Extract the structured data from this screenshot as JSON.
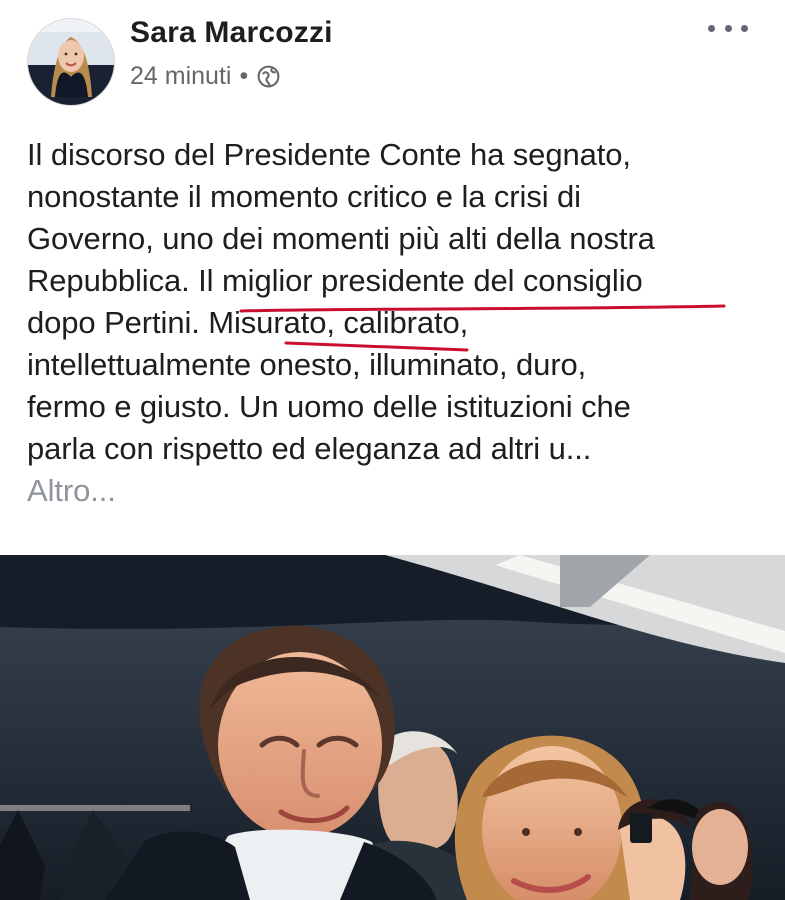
{
  "post": {
    "author": "Sara Marcozzi",
    "time": "24 minuti",
    "separator": "•",
    "privacy_icon": "globe-icon",
    "more_icon": "more-options-icon"
  },
  "text": {
    "lines": [
      "Il discorso del Presidente Conte ha segnato,",
      "nonostante il momento critico e la crisi di",
      "Governo, uno dei momenti più alti della nostra",
      "Repubblica. Il miglior presidente del consiglio",
      "dopo Pertini. Misurato, calibrato,",
      "intellettualmente onesto, illuminato, duro,",
      "fermo e giusto. Un uomo delle istituzioni che",
      "parla con rispetto ed eleganza ad altri u..."
    ],
    "more": "Altro..."
  },
  "colors": {
    "name": "#1c1e21",
    "secondary": "#65676b",
    "link": "#90949c",
    "underline": "#c8102e"
  }
}
